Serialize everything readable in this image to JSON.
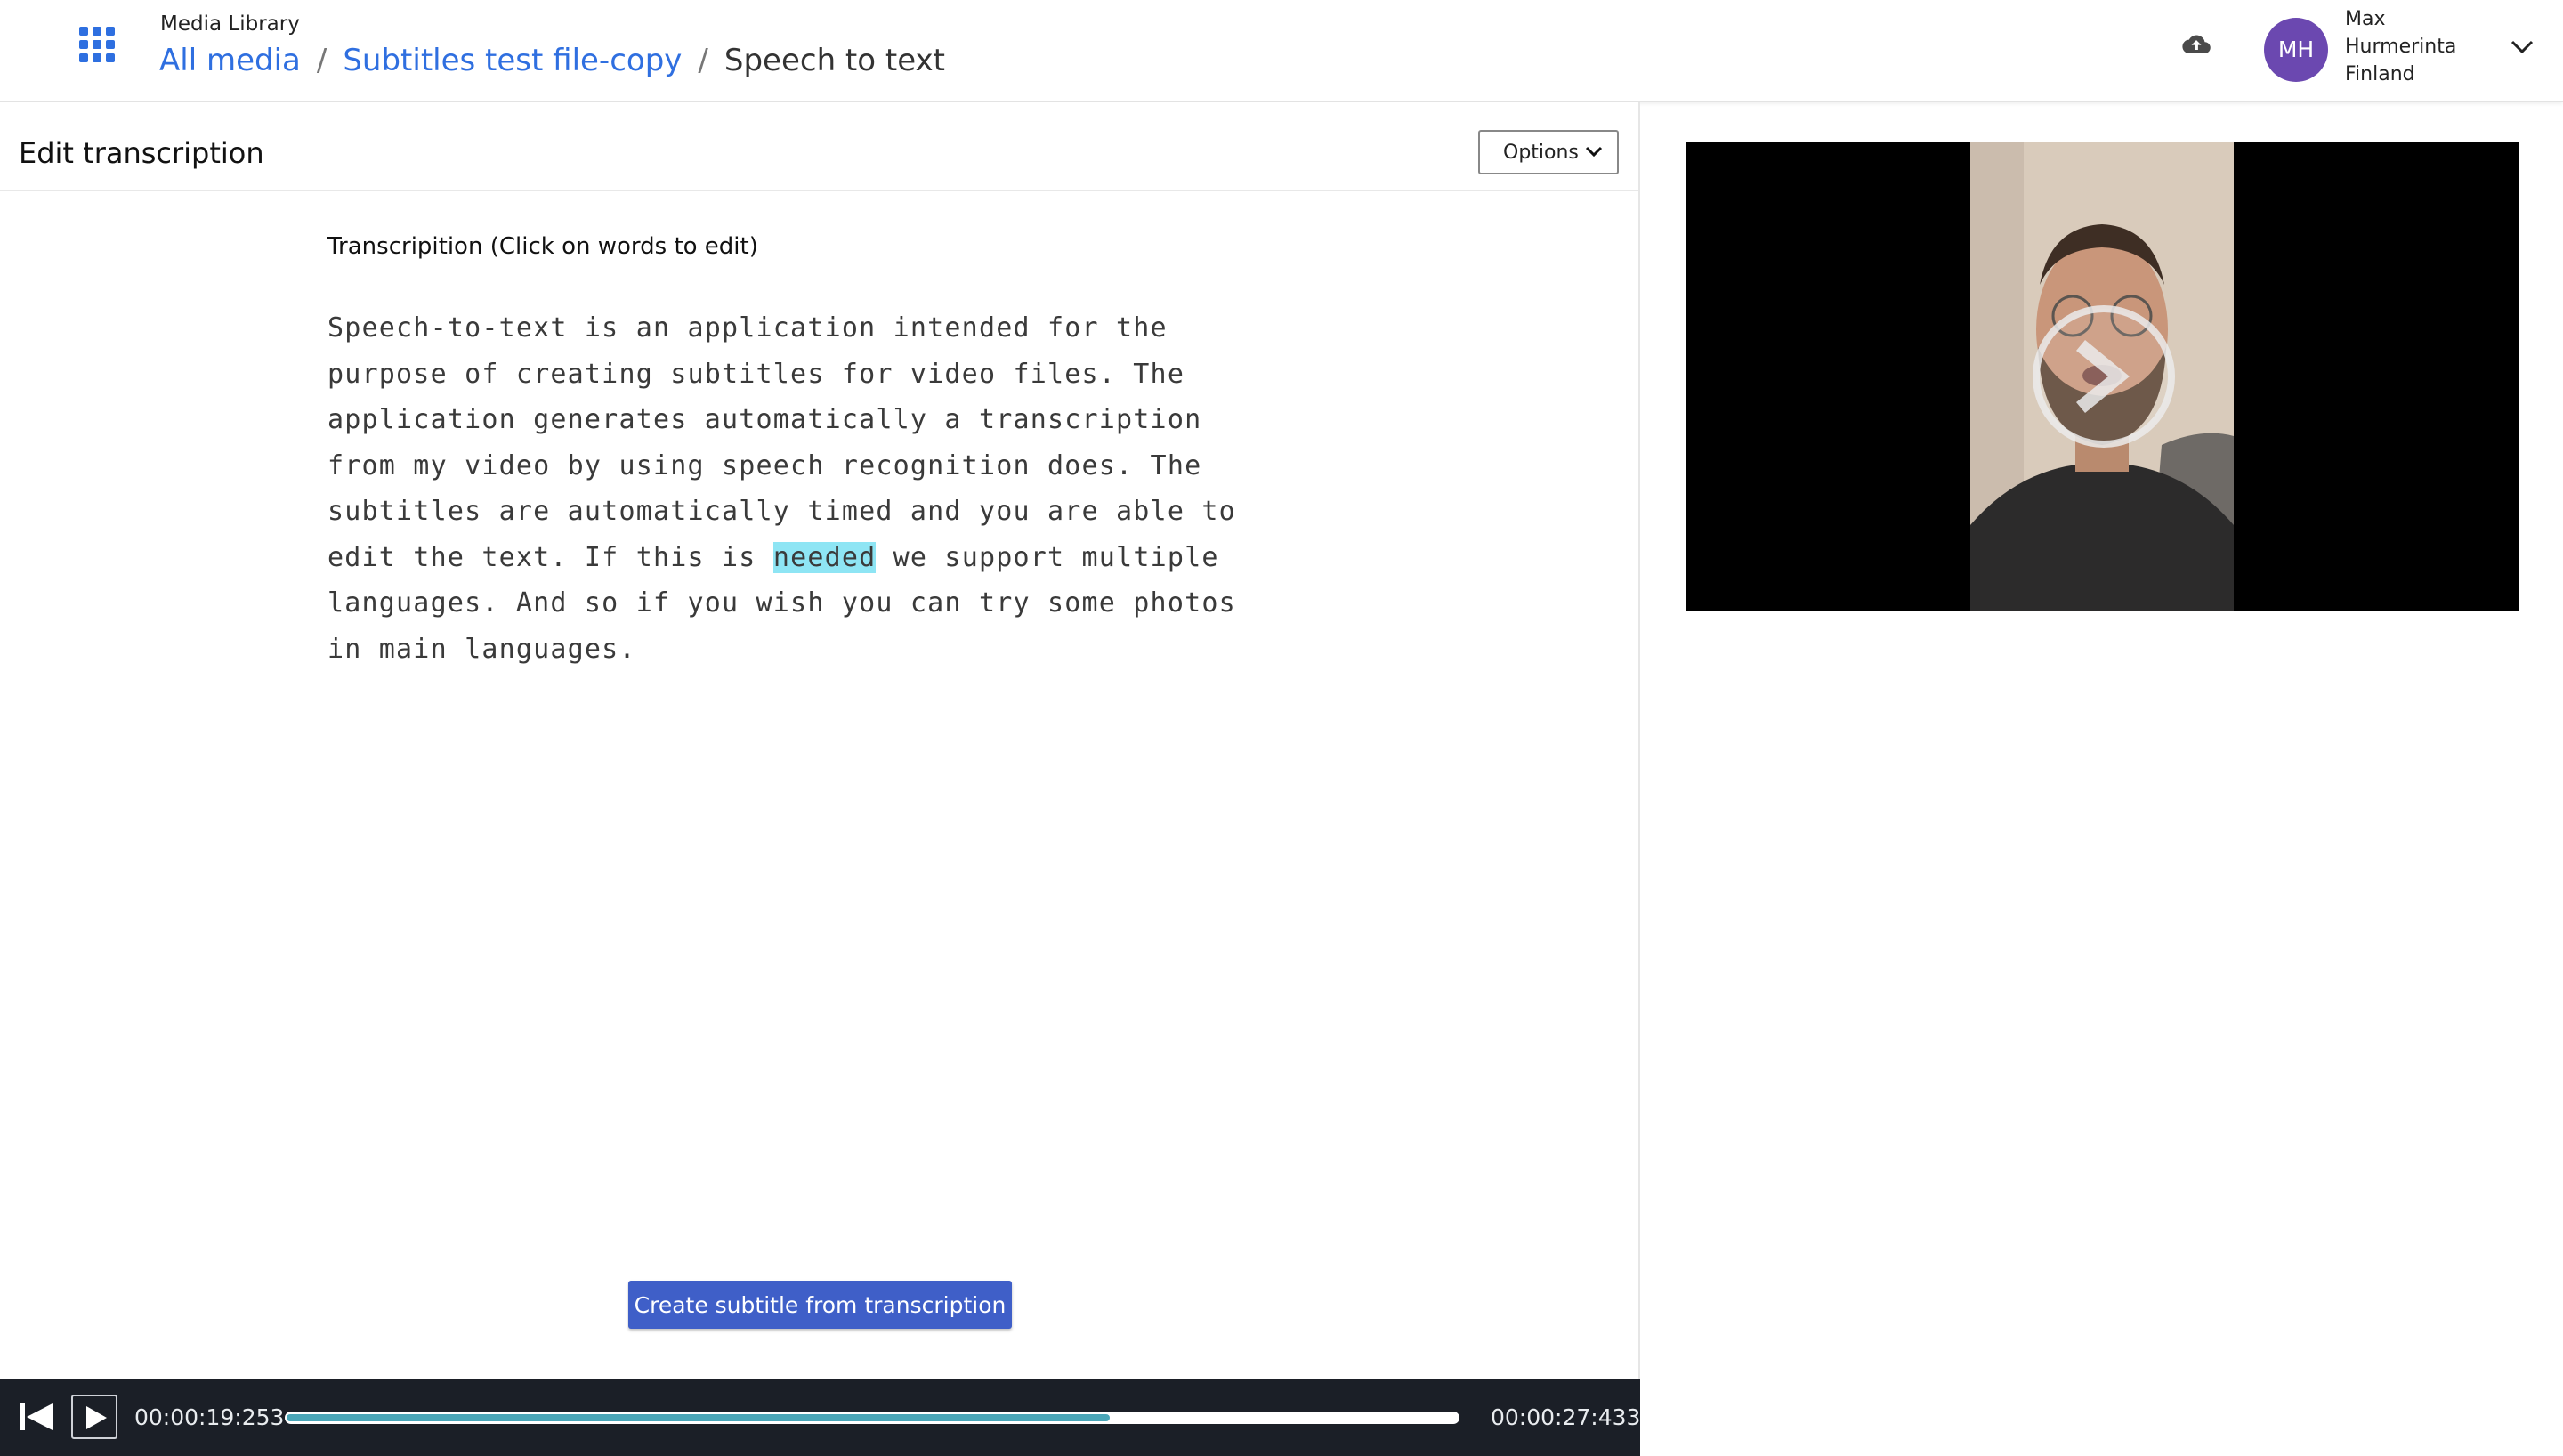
{
  "header": {
    "app_name": "Media Library",
    "breadcrumbs": [
      {
        "label": "All media"
      },
      {
        "label": "Subtitles test file-copy"
      },
      {
        "label": "Speech to text"
      }
    ],
    "separator": "/",
    "user": {
      "initials": "MH",
      "name_lines": [
        "Max",
        "Hurmerinta",
        "Finland"
      ]
    }
  },
  "editor": {
    "title": "Edit transcription",
    "options_label": "Options",
    "transcription_label": "Transcripition (Click on words to edit)",
    "lines": [
      {
        "text": "Speech-to-text is an application intended for the"
      },
      {
        "text": "purpose of creating subtitles for video files. The"
      },
      {
        "text": "application generates automatically a transcription"
      },
      {
        "text": "from my video by using speech recognition does. The"
      },
      {
        "text": "subtitles are automatically timed and you are able to"
      },
      {
        "before": "edit the text. If this is ",
        "highlight": "needed",
        "after": " we support multiple"
      },
      {
        "text": "languages. And so if you wish you can try some photos"
      },
      {
        "text": "in main languages."
      }
    ],
    "create_button_label": "Create subtitle from transcription"
  },
  "player": {
    "current_time": "00:00:19:253",
    "total_time": "00:00:27:433",
    "progress_fraction": 0.703
  },
  "colors": {
    "link": "#2f6fe0",
    "highlight": "#8ee5f4",
    "button": "#3f5fc8",
    "player_bg": "#1b1f27",
    "progress": "#4aa6b8",
    "avatar": "#6b48b0"
  },
  "icons": [
    "apps-grid-icon",
    "cloud-upload-icon",
    "chevron-down-icon",
    "skip-back-icon",
    "play-icon",
    "video-play-icon"
  ]
}
